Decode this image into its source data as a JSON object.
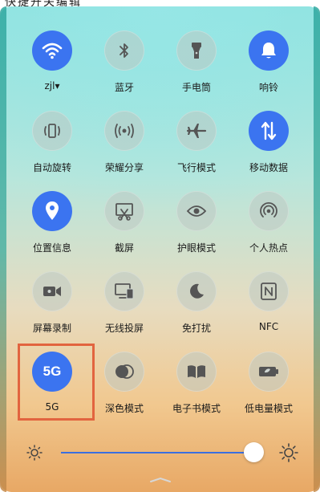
{
  "caption": "快捷开关编辑",
  "tiles": [
    {
      "label": "zjl▾",
      "icon": "wifi-icon",
      "active": true
    },
    {
      "label": "蓝牙",
      "icon": "bluetooth-icon",
      "active": false
    },
    {
      "label": "手电筒",
      "icon": "flashlight-icon",
      "active": false
    },
    {
      "label": "响铃",
      "icon": "bell-icon",
      "active": true
    },
    {
      "label": "自动旋转",
      "icon": "auto-rotate-icon",
      "active": false
    },
    {
      "label": "荣耀分享",
      "icon": "share-icon",
      "active": false
    },
    {
      "label": "飞行模式",
      "icon": "airplane-icon",
      "active": false
    },
    {
      "label": "移动数据",
      "icon": "mobile-data-icon",
      "active": true
    },
    {
      "label": "位置信息",
      "icon": "location-icon",
      "active": true
    },
    {
      "label": "截屏",
      "icon": "screenshot-icon",
      "active": false
    },
    {
      "label": "护眼模式",
      "icon": "eye-icon",
      "active": false
    },
    {
      "label": "个人热点",
      "icon": "hotspot-icon",
      "active": false
    },
    {
      "label": "屏幕录制",
      "icon": "screen-record-icon",
      "active": false
    },
    {
      "label": "无线投屏",
      "icon": "wireless-projection-icon",
      "active": false
    },
    {
      "label": "免打扰",
      "icon": "moon-icon",
      "active": false
    },
    {
      "label": "NFC",
      "icon": "nfc-icon",
      "active": false
    },
    {
      "label": "5G",
      "icon": "5g-icon",
      "icon_text": "5G",
      "active": true
    },
    {
      "label": "深色模式",
      "icon": "dark-mode-icon",
      "active": false
    },
    {
      "label": "电子书模式",
      "icon": "ebook-icon",
      "active": false
    },
    {
      "label": "低电量模式",
      "icon": "battery-saver-icon",
      "active": false
    }
  ],
  "brightness": {
    "level": 0.96
  },
  "colors": {
    "active": "#3b74f0",
    "highlight": "#e2643f",
    "slider": "#3b6fe0"
  }
}
